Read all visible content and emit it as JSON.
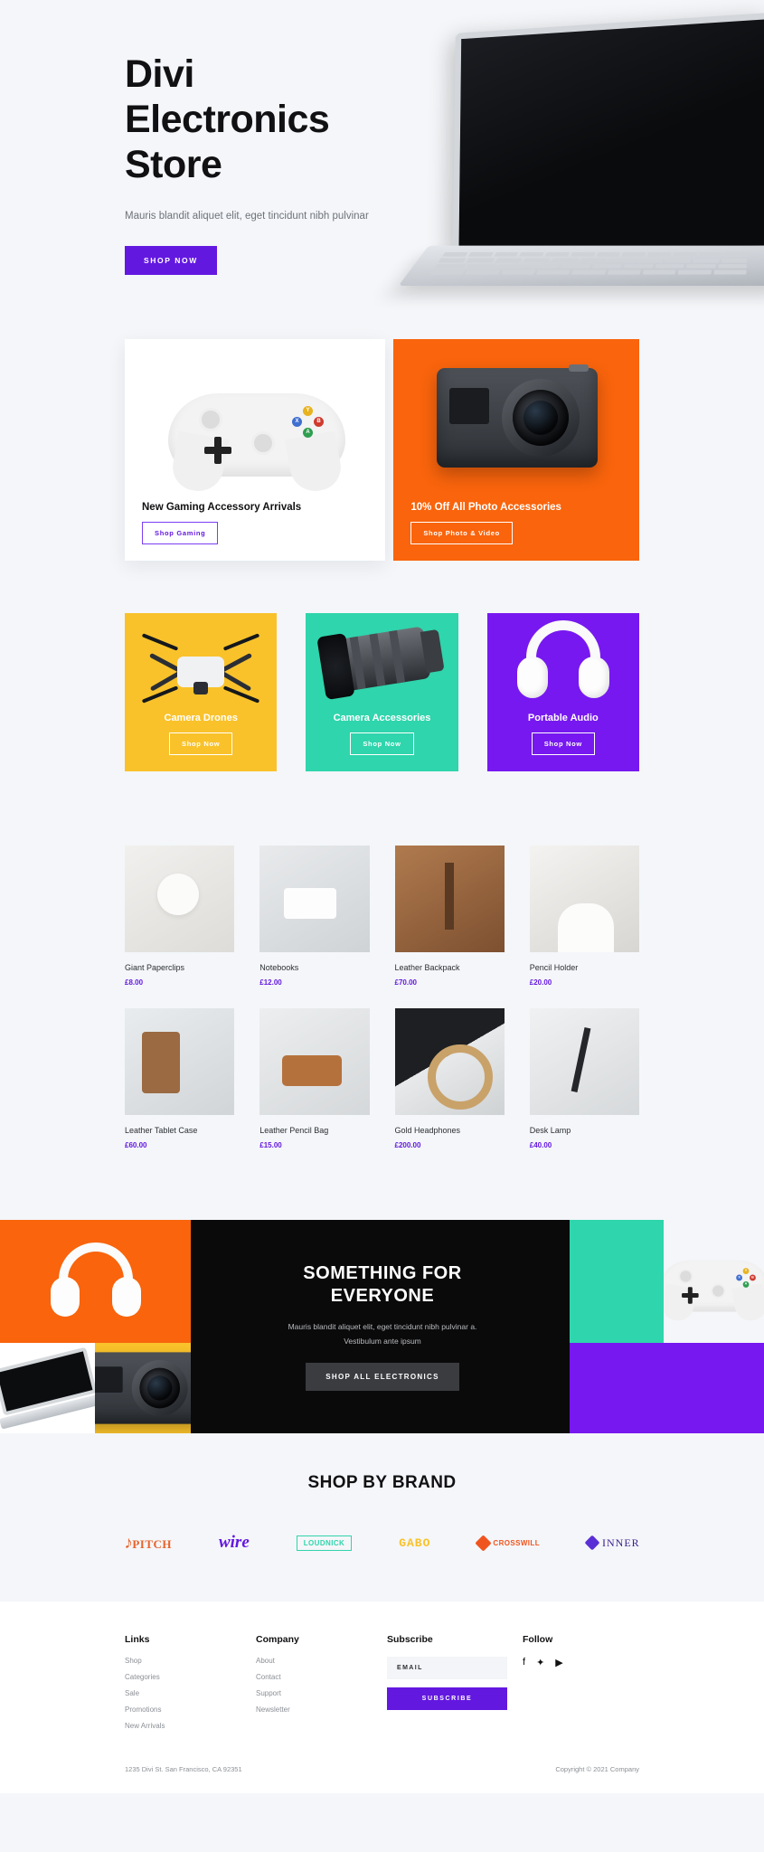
{
  "hero": {
    "title_lines": [
      "Divi",
      "Electronics",
      "Store"
    ],
    "subtitle": "Mauris blandit aliquet elit, eget tincidunt nibh pulvinar",
    "cta": "SHOP NOW",
    "cta_color": "#6318e0"
  },
  "promos": [
    {
      "heading": "New Gaming Accessory Arrivals",
      "cta": "Shop Gaming",
      "bg": "#ffffff"
    },
    {
      "heading": "10% Off All Photo Accessories",
      "cta": "Shop Photo & Video",
      "bg": "#f9640c"
    }
  ],
  "categories": [
    {
      "label": "Camera Drones",
      "cta": "Shop Now",
      "color": "#f9c22b"
    },
    {
      "label": "Camera Accessories",
      "cta": "Shop Now",
      "color": "#2fd5ac"
    },
    {
      "label": "Portable Audio",
      "cta": "Shop Now",
      "color": "#7718f0"
    }
  ],
  "products": [
    {
      "name": "Giant Paperclips",
      "price": "£8.00"
    },
    {
      "name": "Notebooks",
      "price": "£12.00"
    },
    {
      "name": "Leather Backpack",
      "price": "£70.00"
    },
    {
      "name": "Pencil Holder",
      "price": "£20.00"
    },
    {
      "name": "Leather Tablet Case",
      "price": "£60.00"
    },
    {
      "name": "Leather Pencil Bag",
      "price": "£15.00"
    },
    {
      "name": "Gold Headphones",
      "price": "£200.00"
    },
    {
      "name": "Desk Lamp",
      "price": "£40.00"
    }
  ],
  "mosaic": {
    "title": "SOMETHING FOR EVERYONE",
    "subtitle": "Mauris blandit aliquet elit, eget tincidunt nibh pulvinar a. Vestibulum ante ipsum",
    "cta": "SHOP ALL ELECTRONICS"
  },
  "brands": {
    "title": "SHOP BY BRAND",
    "items": [
      {
        "name": "PITCH",
        "color": "#e8622a"
      },
      {
        "name": "wire",
        "color": "#6318e0"
      },
      {
        "name": "LOUDNICK",
        "color": "#2fd5ac"
      },
      {
        "name": "GABO",
        "color": "#f9c22b"
      },
      {
        "name": "CROSSWILL",
        "color": "#f0541e"
      },
      {
        "name": "INNER",
        "color": "#3b1f8f"
      }
    ]
  },
  "footer": {
    "links": {
      "heading": "Links",
      "items": [
        "Shop",
        "Categories",
        "Sale",
        "Promotions",
        "New Arrivals"
      ]
    },
    "company": {
      "heading": "Company",
      "items": [
        "About",
        "Contact",
        "Support",
        "Newsletter"
      ]
    },
    "subscribe": {
      "heading": "Subscribe",
      "placeholder": "EMAIL",
      "value": "EMAIL",
      "button": "SUBSCRIBE"
    },
    "follow": {
      "heading": "Follow",
      "icons": [
        "facebook-icon",
        "twitter-icon",
        "youtube-icon"
      ],
      "glyphs": [
        "f",
        "✦",
        "▶"
      ]
    },
    "address": "1235 Divi St. San Francisco, CA 92351",
    "copyright": "Copyright © 2021 Company"
  }
}
